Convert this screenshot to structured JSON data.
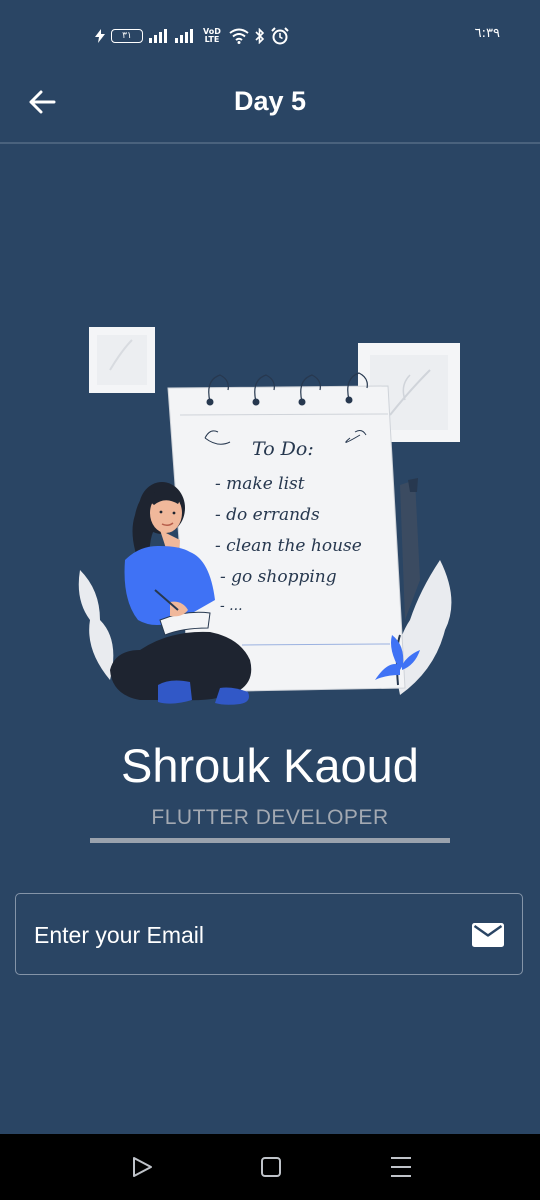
{
  "status_bar": {
    "battery": "٣١",
    "network": "VoD LTE",
    "time": "٦:٣٩"
  },
  "app_bar": {
    "title": "Day 5",
    "back_icon": "arrow-left-icon"
  },
  "illustration": {
    "todo_title": "To Do:",
    "todo_items": [
      "- make list",
      "- do errands",
      "- clean the house",
      "- go shopping",
      "- ..."
    ]
  },
  "profile": {
    "name": "Shrouk Kaoud",
    "role": "FLUTTER DEVELOPER"
  },
  "email_field": {
    "placeholder": "Enter your Email",
    "icon": "mail-icon"
  },
  "nav_bar": {
    "back": "play-back-icon",
    "home": "square-home-icon",
    "recents": "menu-lines-icon"
  },
  "colors": {
    "background": "#2a4564",
    "text": "#ffffff",
    "role": "#a3a9b2",
    "accent_blue": "#3f72f5"
  }
}
